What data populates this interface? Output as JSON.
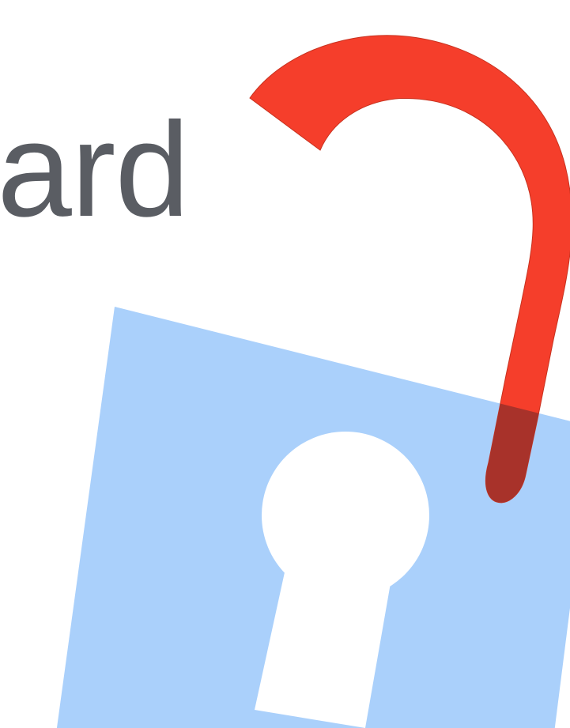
{
  "headline": {
    "text": "board"
  },
  "illustration": {
    "icon": "unlocked-padlock-icon",
    "colors": {
      "lock_body": "#aad0fb",
      "shackle": "#f53e2b",
      "shackle_overlap": "#a8322a",
      "keyhole": "#ffffff"
    }
  }
}
